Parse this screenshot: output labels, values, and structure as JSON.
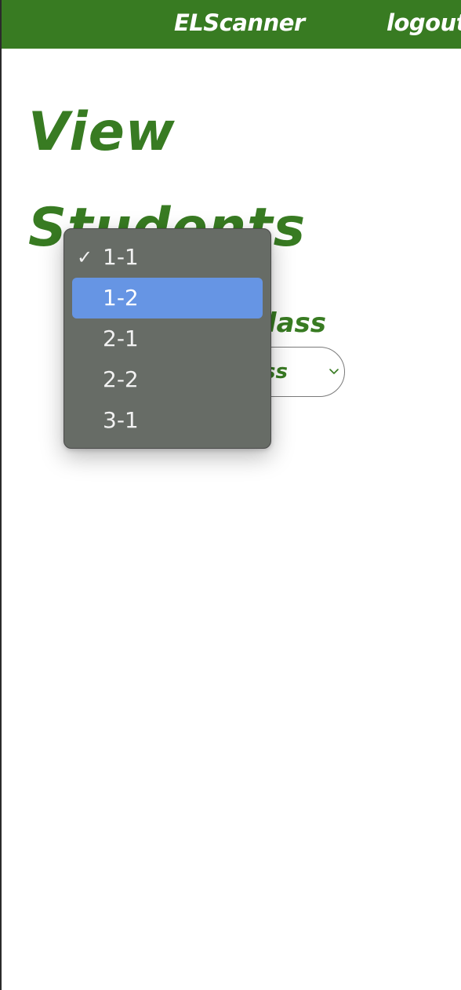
{
  "navbar": {
    "brand": "ELScanner",
    "logout_label": "logout"
  },
  "page": {
    "title": "View Students",
    "class_label": "Class",
    "select_value": "Class"
  },
  "dropdown": {
    "selected": "1-1",
    "highlighted": "1-2",
    "check_glyph": "✓",
    "options": [
      {
        "label": "1-1"
      },
      {
        "label": "1-2"
      },
      {
        "label": "2-1"
      },
      {
        "label": "2-2"
      },
      {
        "label": "3-1"
      }
    ]
  },
  "colors": {
    "brand_green": "#387b22",
    "menu_background": "#676c66",
    "menu_highlight": "#6695e4"
  },
  "icons": {
    "select_indicator": "chevron-down-icon",
    "selected_marker": "checkmark-icon"
  }
}
